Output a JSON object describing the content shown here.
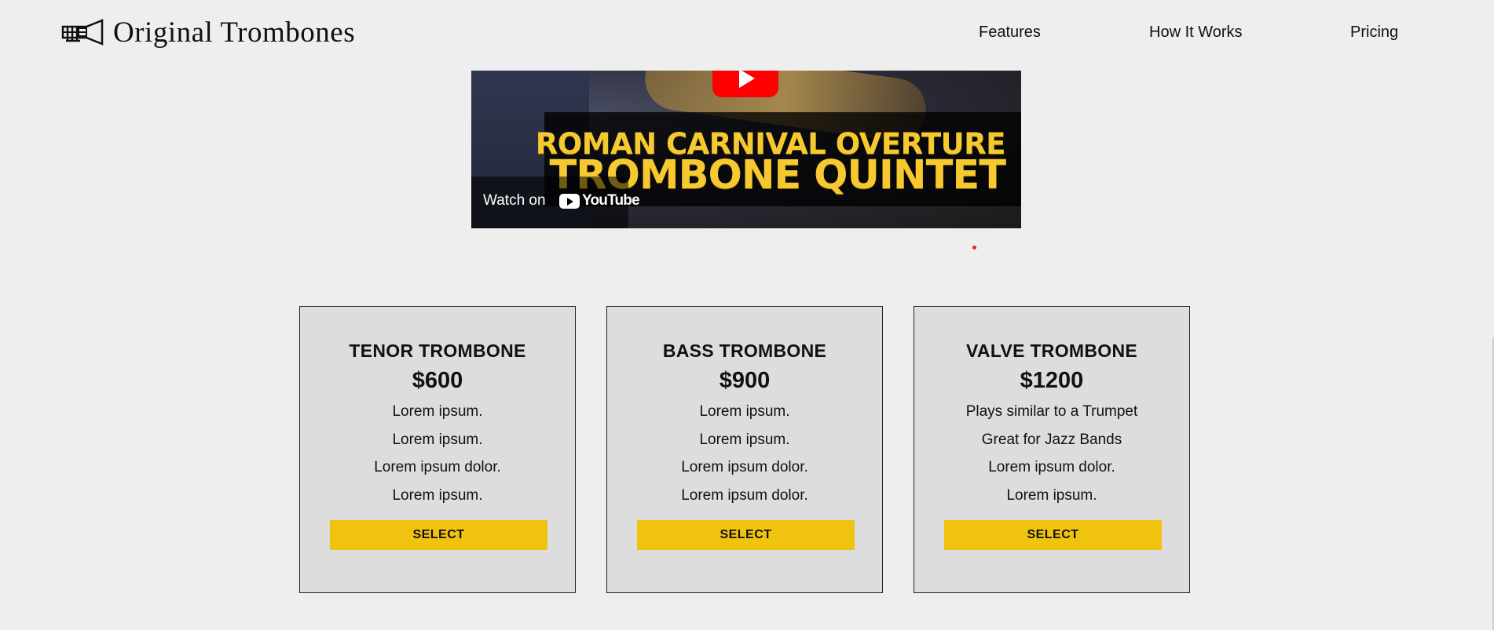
{
  "header": {
    "logo_text": "Original Trombones",
    "logo_icon": "trombone-logo-icon",
    "nav": [
      {
        "label": "Features"
      },
      {
        "label": "How It Works"
      },
      {
        "label": "Pricing"
      }
    ]
  },
  "video": {
    "title_line_1": "ROMAN CARNIVAL OVERTURE",
    "title_line_2": "TROMBONE QUINTET",
    "watch_on": "Watch on",
    "youtube": "YouTube",
    "play_icon": "play-icon",
    "colors": {
      "title": "#f6c930",
      "play": "#ff0000"
    }
  },
  "pricing": {
    "accent": "#f0c30f",
    "cards": [
      {
        "name": "TENOR TROMBONE",
        "price": "$600",
        "features": [
          "Lorem ipsum.",
          "Lorem ipsum.",
          "Lorem ipsum dolor.",
          "Lorem ipsum."
        ],
        "button": "SELECT"
      },
      {
        "name": "BASS TROMBONE",
        "price": "$900",
        "features": [
          "Lorem ipsum.",
          "Lorem ipsum.",
          "Lorem ipsum dolor.",
          "Lorem ipsum dolor."
        ],
        "button": "SELECT"
      },
      {
        "name": "VALVE TROMBONE",
        "price": "$1200",
        "features": [
          "Plays similar to a Trumpet",
          "Great for Jazz Bands",
          "Lorem ipsum dolor.",
          "Lorem ipsum."
        ],
        "button": "SELECT"
      }
    ]
  }
}
